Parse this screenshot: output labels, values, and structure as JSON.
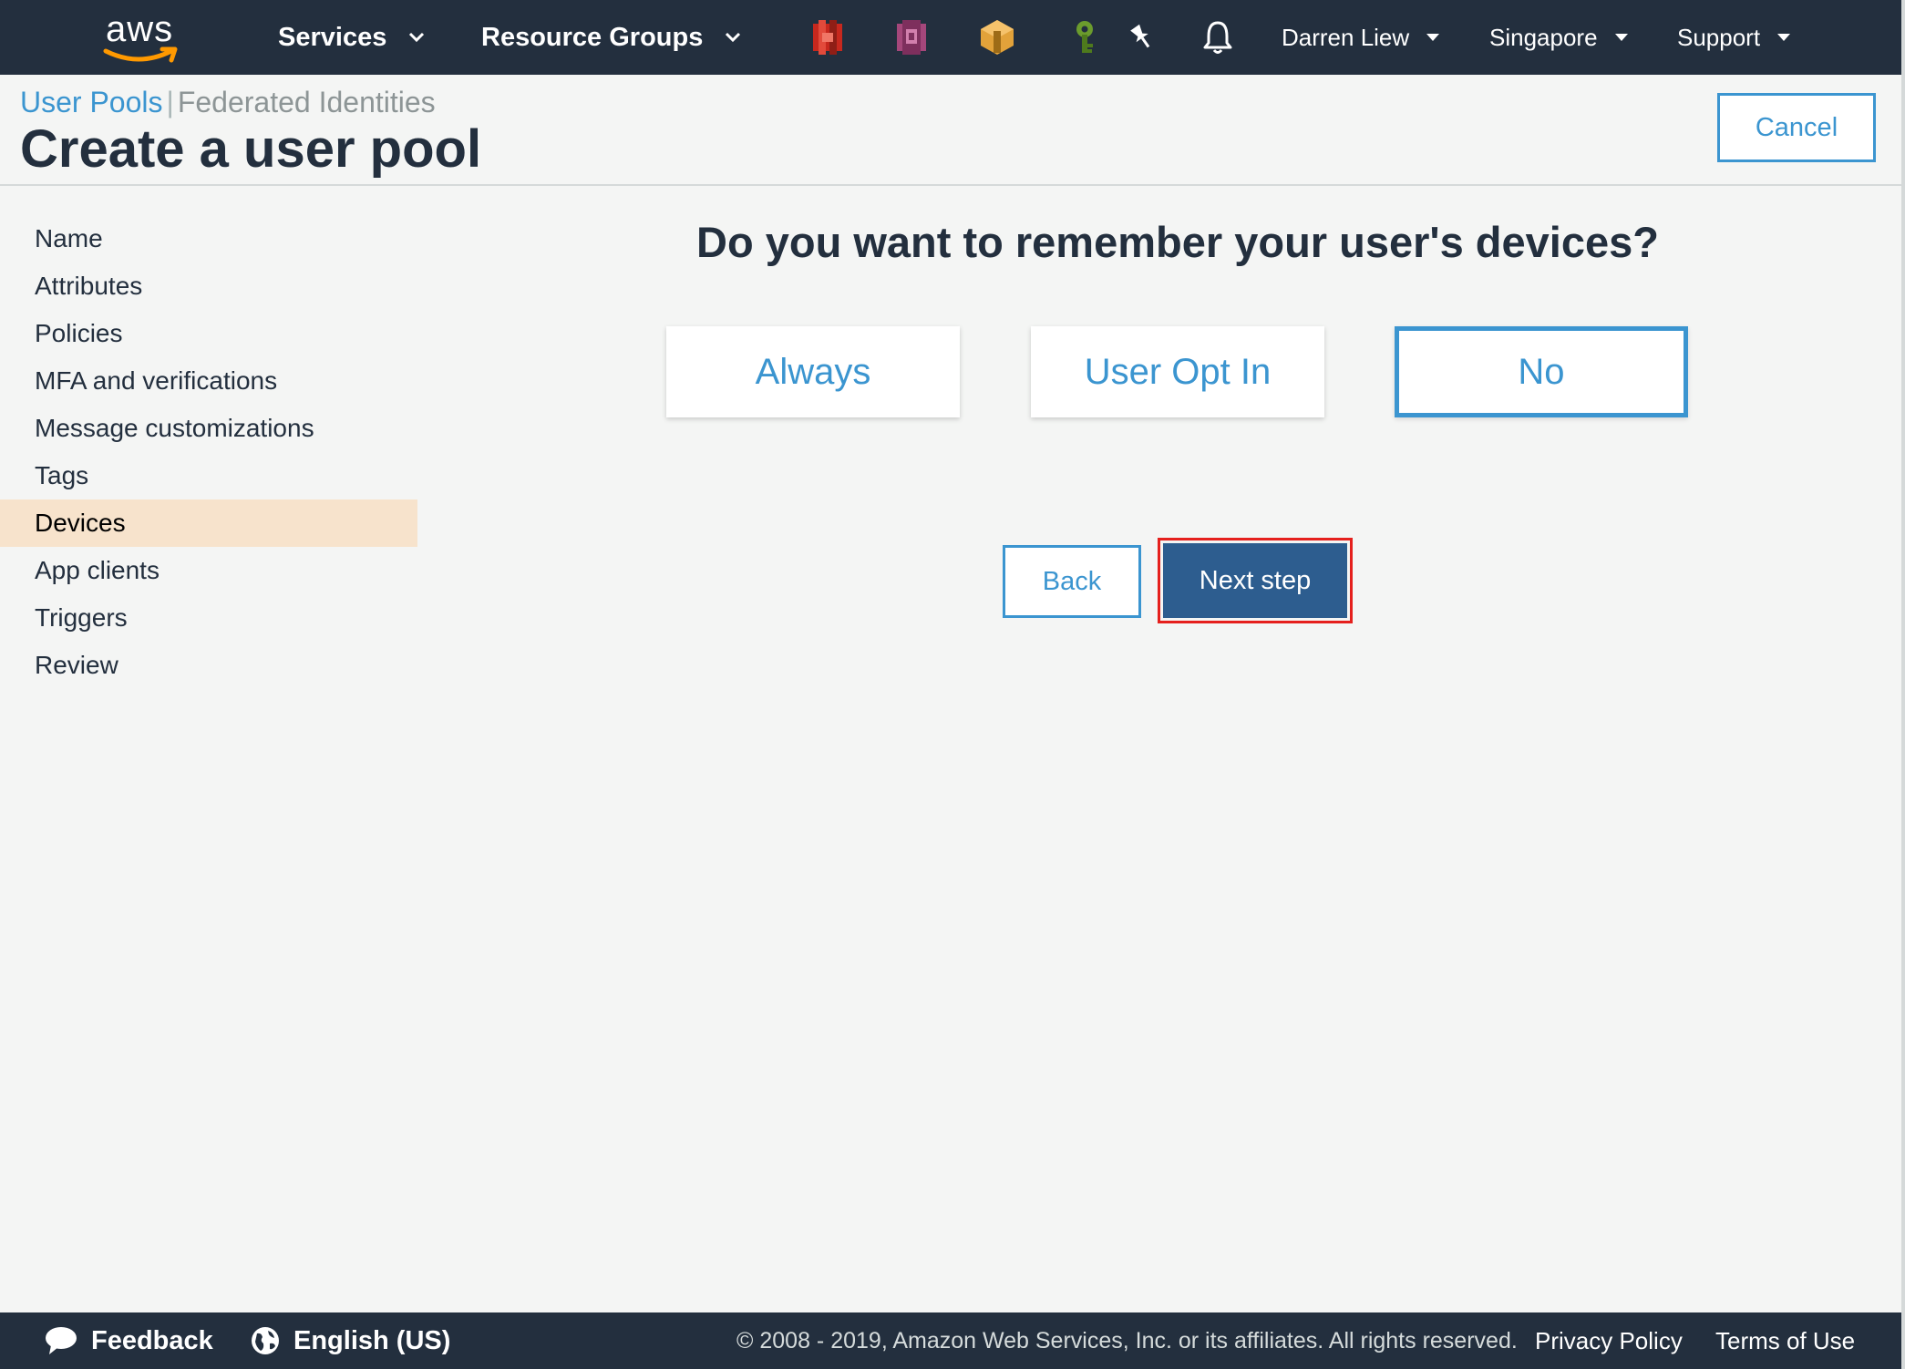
{
  "topnav": {
    "logo": "aws",
    "services_label": "Services",
    "resource_groups_label": "Resource Groups",
    "pinned_icons": [
      "aws-service-red-icon",
      "cognito-icon",
      "aws-service-orange-icon",
      "key-icon"
    ],
    "pin_icon": "pin-icon",
    "bell_icon": "bell-icon",
    "account_label": "Darren Liew",
    "region_label": "Singapore",
    "support_label": "Support"
  },
  "breadcrumb": {
    "user_pools": "User Pools",
    "separator": "|",
    "federated_identities": "Federated Identities"
  },
  "page_title": "Create a user pool",
  "cancel_label": "Cancel",
  "sidebar": {
    "items": [
      {
        "label": "Name"
      },
      {
        "label": "Attributes"
      },
      {
        "label": "Policies"
      },
      {
        "label": "MFA and verifications"
      },
      {
        "label": "Message customizations"
      },
      {
        "label": "Tags"
      },
      {
        "label": "Devices",
        "active": true
      },
      {
        "label": "App clients"
      },
      {
        "label": "Triggers"
      },
      {
        "label": "Review"
      }
    ]
  },
  "main": {
    "question": "Do you want to remember your user's devices?",
    "options": [
      {
        "label": "Always",
        "selected": false
      },
      {
        "label": "User Opt In",
        "selected": false
      },
      {
        "label": "No",
        "selected": true
      }
    ],
    "back_label": "Back",
    "next_label": "Next step"
  },
  "footer": {
    "feedback_label": "Feedback",
    "language_label": "English (US)",
    "copyright": "© 2008 - 2019, Amazon Web Services, Inc. or its affiliates. All rights reserved.",
    "privacy_label": "Privacy Policy",
    "terms_label": "Terms of Use"
  },
  "colors": {
    "nav_bg": "#232f3e",
    "link_blue": "#3b95d0",
    "primary_button": "#2d5d8f",
    "active_sidebar": "#f7e3cc",
    "highlight_red": "#e5201d",
    "aws_orange": "#ff9900"
  }
}
